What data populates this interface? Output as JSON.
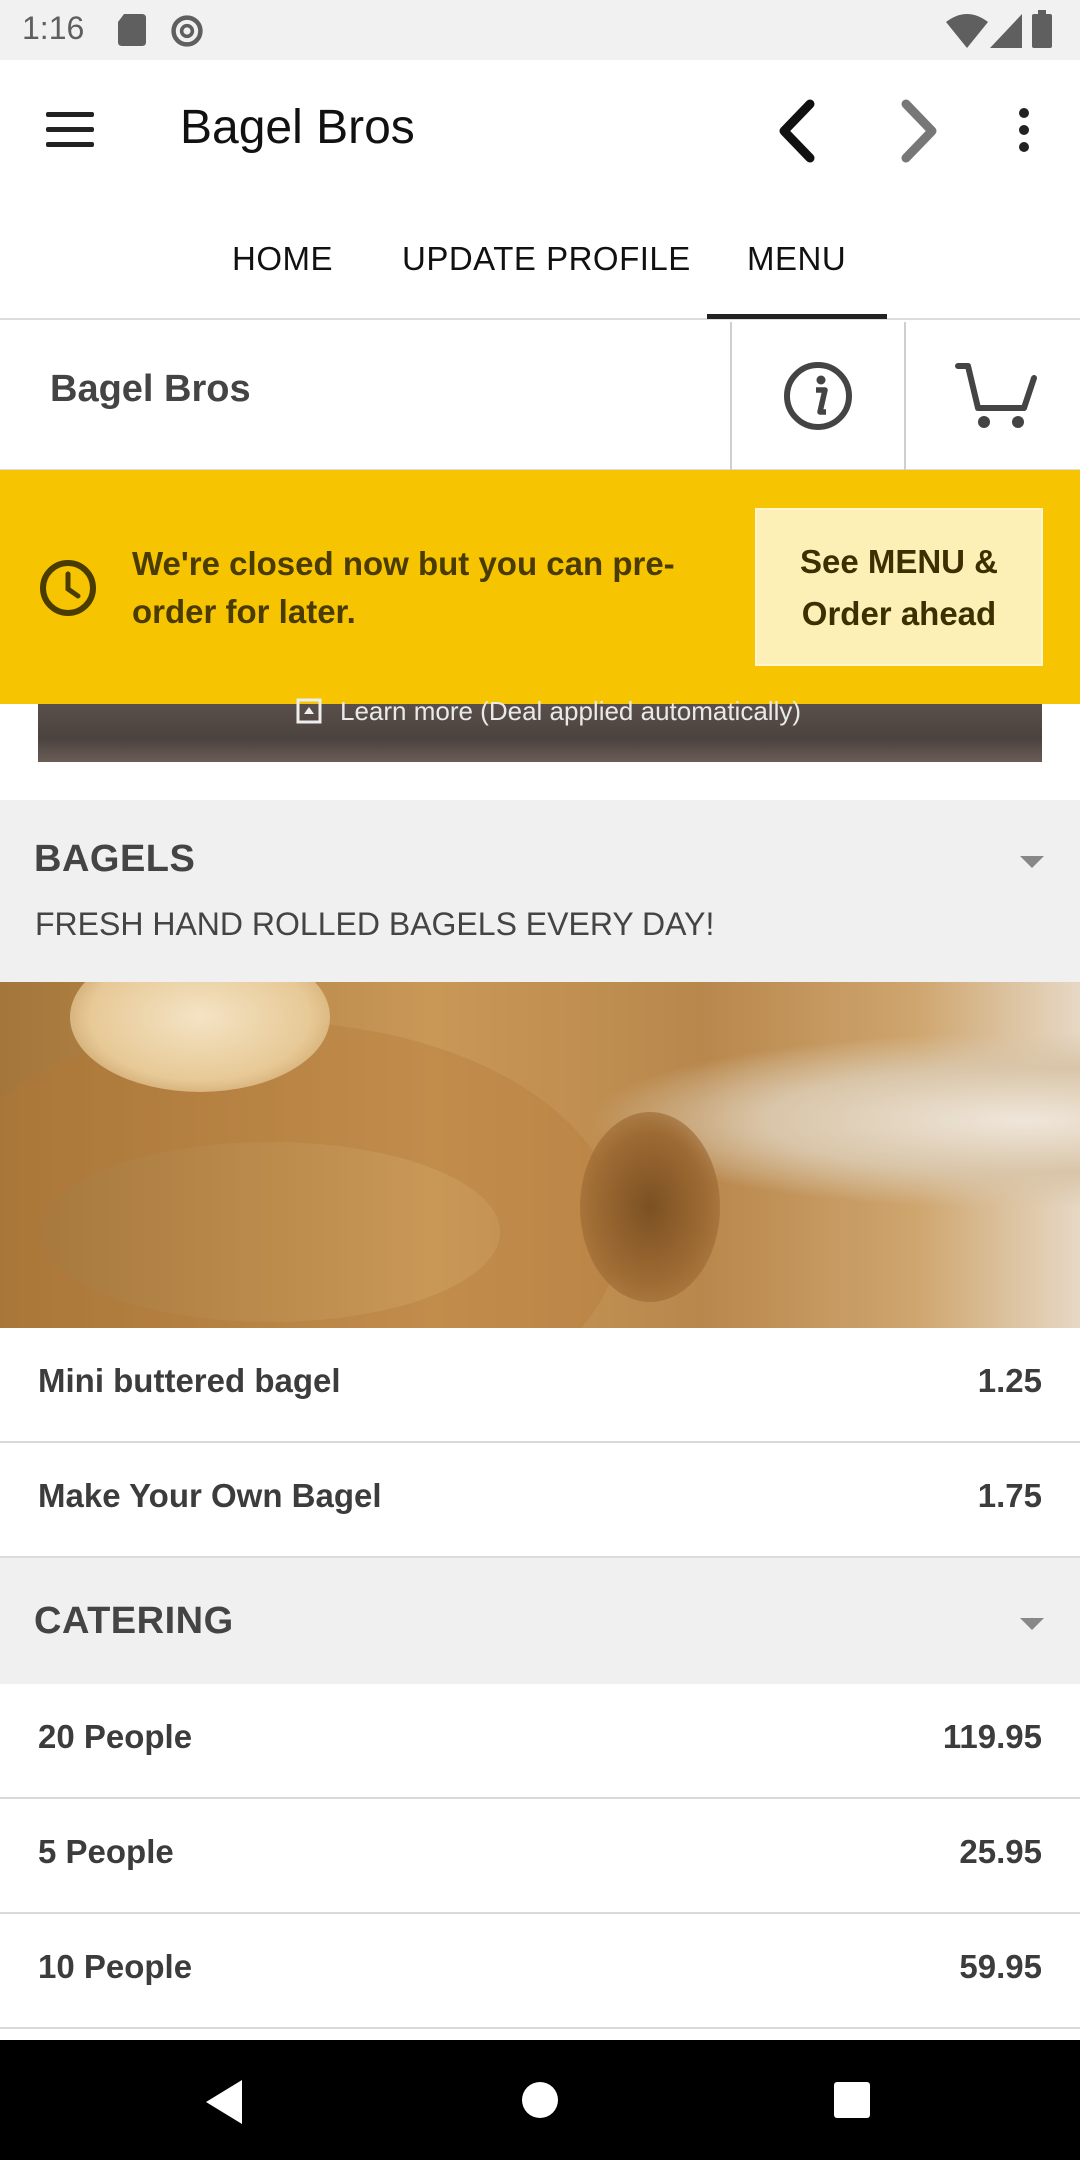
{
  "status_bar": {
    "time": "1:16",
    "icons": [
      "sd-card-icon",
      "at-sign-icon",
      "wifi-icon",
      "cell-signal-icon",
      "battery-icon"
    ]
  },
  "app_bar": {
    "title": "Bagel Bros",
    "icons": [
      "menu-icon",
      "back-arrow-icon",
      "forward-arrow-icon",
      "overflow-menu-icon"
    ]
  },
  "tabs": [
    {
      "label": "HOME",
      "selected": false
    },
    {
      "label": "UPDATE PROFILE",
      "selected": false
    },
    {
      "label": "MENU",
      "selected": true
    }
  ],
  "restaurant": {
    "name": "Bagel Bros"
  },
  "banner": {
    "message": "We're closed now but you can pre-order for later.",
    "button": "See MENU & Order ahead",
    "color": "#f6c400"
  },
  "hero": {
    "learn_more": "Learn more (Deal applied automatically)"
  },
  "categories": [
    {
      "title": "BAGELS",
      "subtitle": "FRESH HAND ROLLED BAGELS EVERY DAY!",
      "items": [
        {
          "name": "Mini buttered bagel",
          "price": "1.25"
        },
        {
          "name": "Make Your Own Bagel",
          "price": "1.75"
        }
      ]
    },
    {
      "title": "CATERING",
      "items": [
        {
          "name": "20 People",
          "price": "119.95"
        },
        {
          "name": "5 People",
          "price": "25.95"
        },
        {
          "name": "10 People",
          "price": "59.95"
        }
      ]
    }
  ]
}
